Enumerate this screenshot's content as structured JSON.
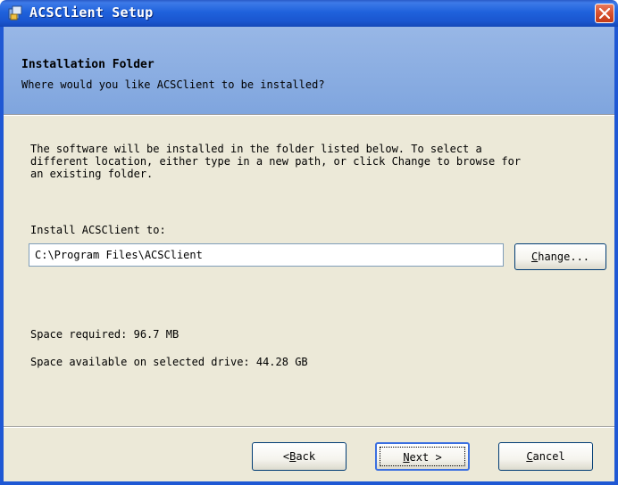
{
  "window": {
    "title": "ACSClient Setup",
    "close_icon": "close-icon"
  },
  "header": {
    "title": "Installation Folder",
    "subtitle": "Where would you like ACSClient to be installed?"
  },
  "body": {
    "description": "The software will be installed in the folder listed below. To select a\ndifferent location, either type in a new path, or click Change to browse for\nan existing folder.",
    "install_label": "Install ACSClient to:",
    "install_path": "C:\\Program Files\\ACSClient",
    "change_label_accel": "C",
    "change_label_rest": "hange...",
    "space_required": "Space required: 96.7 MB",
    "space_available": "Space available on selected drive: 44.28 GB"
  },
  "footer": {
    "back_prefix": "< ",
    "back_accel": "B",
    "back_rest": "ack",
    "next_accel": "N",
    "next_rest": "ext >",
    "cancel_accel": "C",
    "cancel_rest": "ancel"
  },
  "colors": {
    "titlebar": "#1f62dc",
    "header_band": "#7fa5de",
    "dialog_bg": "#ece9d8",
    "close_button": "#d8502e"
  }
}
